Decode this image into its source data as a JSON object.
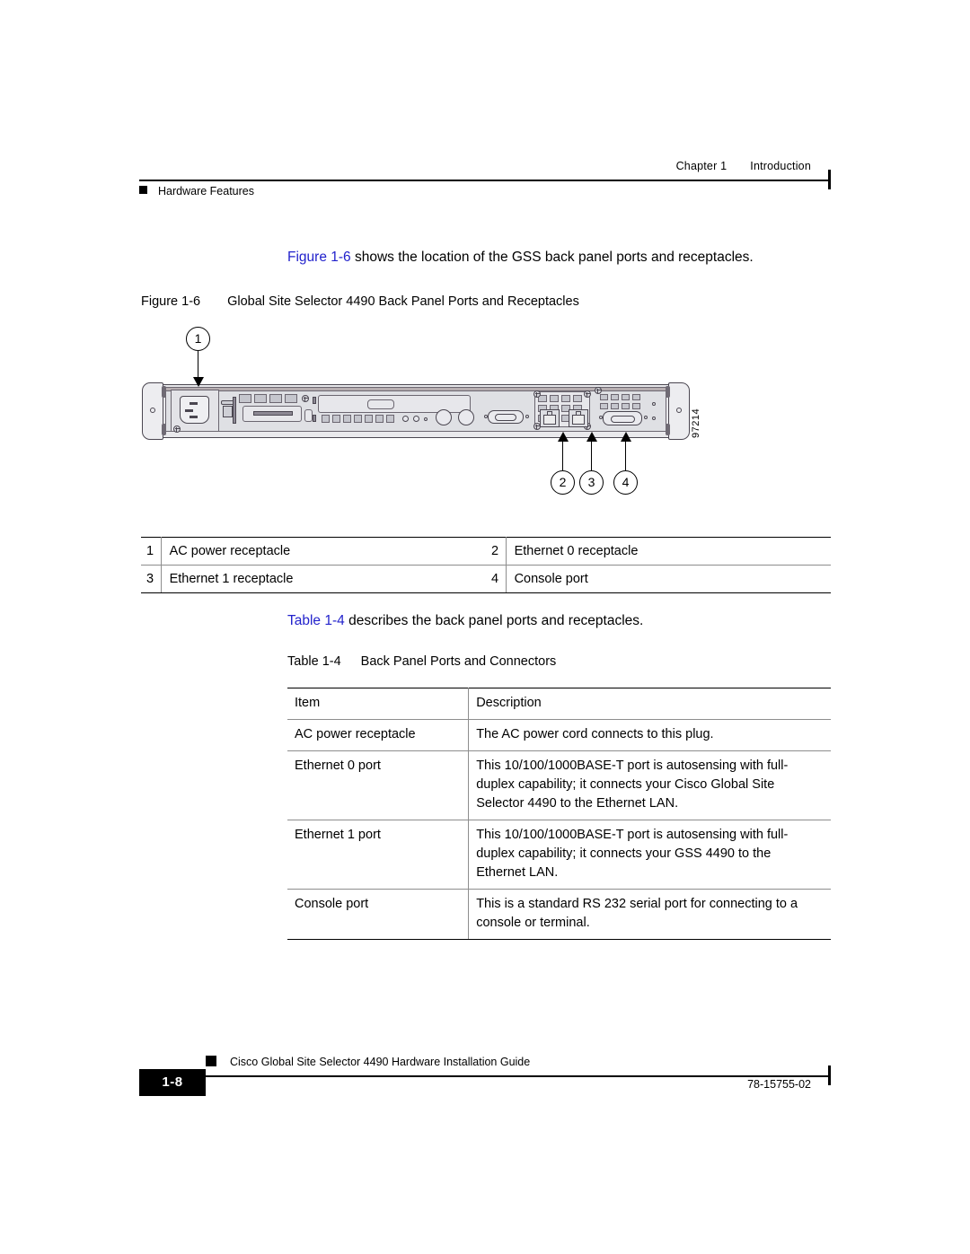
{
  "header": {
    "chapter_number": "Chapter 1",
    "chapter_title": "Introduction",
    "topic": "Hardware Features"
  },
  "intro": {
    "xref": "Figure 1-6",
    "text": " shows the location of the GSS back panel ports and receptacles."
  },
  "figure": {
    "label": "Figure 1-6",
    "title": "Global Site Selector 4490 Back Panel Ports and Receptacles",
    "graphic_id": "97214",
    "callouts": [
      "1",
      "2",
      "3",
      "4"
    ]
  },
  "legend": {
    "rows": [
      {
        "num1": "1",
        "label1": "AC power receptacle",
        "num2": "2",
        "label2": "Ethernet 0 receptacle"
      },
      {
        "num1": "3",
        "label1": "Ethernet 1 receptacle",
        "num2": "4",
        "label2": "Console port"
      }
    ]
  },
  "table_intro": {
    "xref": "Table 1-4",
    "text": " describes the back panel ports and receptacles."
  },
  "table": {
    "label": "Table 1-4",
    "title": "Back Panel Ports and Connectors",
    "columns": [
      "Item",
      "Description"
    ],
    "rows": [
      {
        "item": "AC power receptacle",
        "description": "The AC power cord connects to this plug."
      },
      {
        "item": "Ethernet 0 port",
        "description": "This 10/100/1000BASE-T port is autosensing with full-duplex capability; it connects your Cisco Global Site Selector 4490 to the Ethernet LAN."
      },
      {
        "item": "Ethernet 1 port",
        "description": "This 10/100/1000BASE-T port is autosensing with full-duplex capability; it connects your GSS 4490 to the Ethernet LAN."
      },
      {
        "item": "Console port",
        "description": "This is a standard RS 232 serial port for connecting to a console or terminal."
      }
    ]
  },
  "footer": {
    "page_number": "1-8",
    "guide_title": "Cisco Global Site Selector 4490 Hardware Installation Guide",
    "doc_id": "78-15755-02"
  },
  "colors": {
    "xref_blue": "#2222cc",
    "rule_black": "#000000"
  }
}
